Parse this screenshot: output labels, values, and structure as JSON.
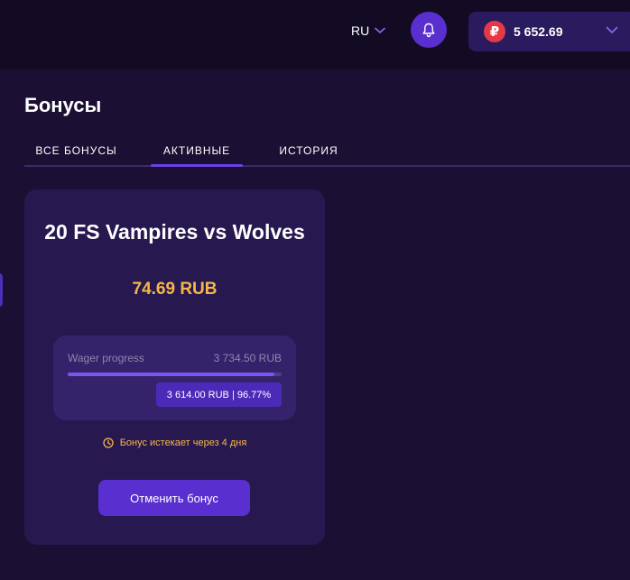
{
  "header": {
    "language": "RU",
    "currency_symbol": "₽",
    "balance": "5 652.69"
  },
  "page": {
    "title": "Бонусы"
  },
  "tabs": [
    {
      "label": "ВСЕ БОНУСЫ",
      "active": false
    },
    {
      "label": "АКТИВНЫЕ",
      "active": true
    },
    {
      "label": "ИСТОРИЯ",
      "active": false
    }
  ],
  "bonus_card": {
    "title": "20 FS Vampires vs Wolves",
    "amount": "74.69 RUB",
    "wager": {
      "label": "Wager progress",
      "total": "3 734.50 RUB",
      "progress_text": "3 614.00 RUB | 96.77%",
      "progress_fraction": 0.9677
    },
    "expiry_text": "Бонус истекает через 4 дня",
    "cancel_label": "Отменить бонус"
  },
  "colors": {
    "background": "#1b1033",
    "topbar": "#130b24",
    "accent": "#5a2fd0",
    "card": "#271850",
    "highlight": "#f5b74a",
    "ruble_badge": "#e63946"
  },
  "icons": {
    "language_dropdown": "chevron-down-icon",
    "notifications": "bell-icon",
    "currency": "ruble-icon",
    "balance_dropdown": "chevron-down-icon",
    "expiry": "clock-icon"
  }
}
